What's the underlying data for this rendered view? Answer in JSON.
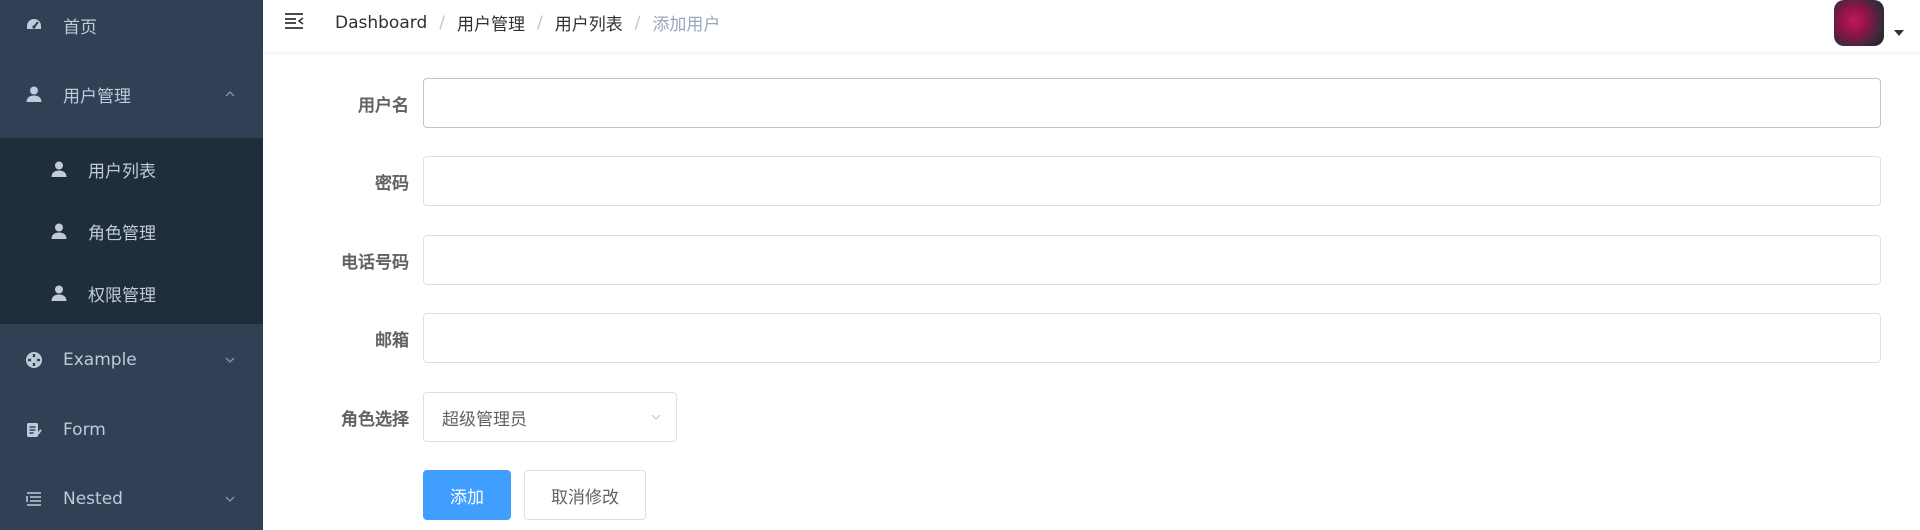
{
  "sidebar": {
    "home": {
      "label": "首页",
      "icon": "dashboard-icon"
    },
    "user_mgmt": {
      "label": "用户管理",
      "icon": "user-icon",
      "expanded": true
    },
    "sub_items": [
      {
        "label": "用户列表",
        "icon": "user-icon"
      },
      {
        "label": "角色管理",
        "icon": "user-icon"
      },
      {
        "label": "权限管理",
        "icon": "user-icon"
      }
    ],
    "example": {
      "label": "Example",
      "icon": "example-icon"
    },
    "form": {
      "label": "Form",
      "icon": "form-icon"
    },
    "nested": {
      "label": "Nested",
      "icon": "nested-icon"
    }
  },
  "breadcrumb": [
    "Dashboard",
    "用户管理",
    "用户列表",
    "添加用户"
  ],
  "form": {
    "username_label": "用户名",
    "password_label": "密码",
    "phone_label": "电话号码",
    "email_label": "邮箱",
    "role_label": "角色选择",
    "role_value": "超级管理员",
    "add_button": "添加",
    "cancel_button": "取消修改"
  },
  "colors": {
    "sidebar_bg": "#304156",
    "submenu_bg": "#1f2d3d",
    "primary": "#409eff"
  }
}
